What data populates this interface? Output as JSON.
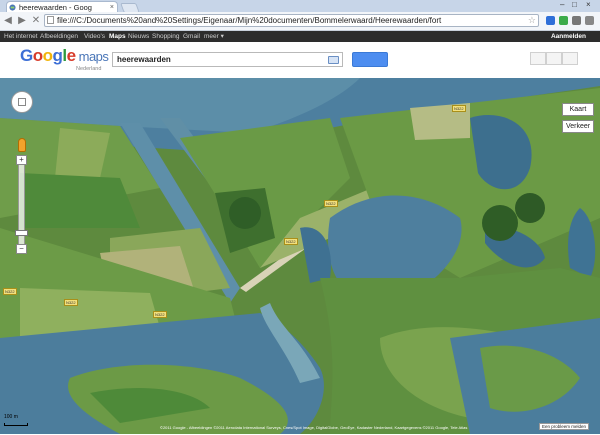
{
  "browser": {
    "tab_title": "heerewaarden - Goog",
    "tab_close": "×",
    "window_controls": {
      "minimize": "–",
      "maximize": "□",
      "close": "×"
    },
    "back_label": "◀",
    "forward_label": "▶",
    "stop_label": "✕",
    "address": "file:///C:/Documents%20and%20Settings/Eigenaar/Mijn%20documenten/Bommelerwaard/Heerewaarden/fort",
    "star": "☆"
  },
  "google_bar": {
    "items": [
      "Het internet",
      "Afbeeldingen",
      "Video's",
      "Maps",
      "Nieuws",
      "Shopping",
      "Gmail",
      "meer ▾"
    ],
    "selected": "Maps",
    "signin": "Aanmelden"
  },
  "header": {
    "logo_letters": [
      "G",
      "o",
      "o",
      "g",
      "l",
      "e"
    ],
    "logo_colors": [
      "#3d6fd6",
      "#d83b2a",
      "#f2b40b",
      "#3d6fd6",
      "#2e9b3f",
      "#d83b2a"
    ],
    "logo_suffix": "maps",
    "logo_sub": "Nederland",
    "search_value": "heerewaarden"
  },
  "map": {
    "buttons": {
      "map_type": "Kaart",
      "traffic": "Verkeer"
    },
    "zoom_in": "+",
    "zoom_out": "−",
    "road_labels": [
      "N322",
      "N322",
      "N322",
      "N322",
      "N322",
      "N322"
    ],
    "scale": "100 m",
    "copyright": "©2011 Google - Afbeeldingen ©2011 Aerodata International Surveys, Cnes/Spot Image, DigitalGlobe, GeoEye, Kadaster Nederland, Kaartgegevens ©2011 Google, Tele Atlas",
    "report": "Een probleem melden"
  },
  "colors": {
    "water": "#4b7ea4",
    "river": "#5e8fa9",
    "field": "#6f9d4a",
    "field_dark": "#3f6f2e",
    "road": "#d9d3b7"
  }
}
